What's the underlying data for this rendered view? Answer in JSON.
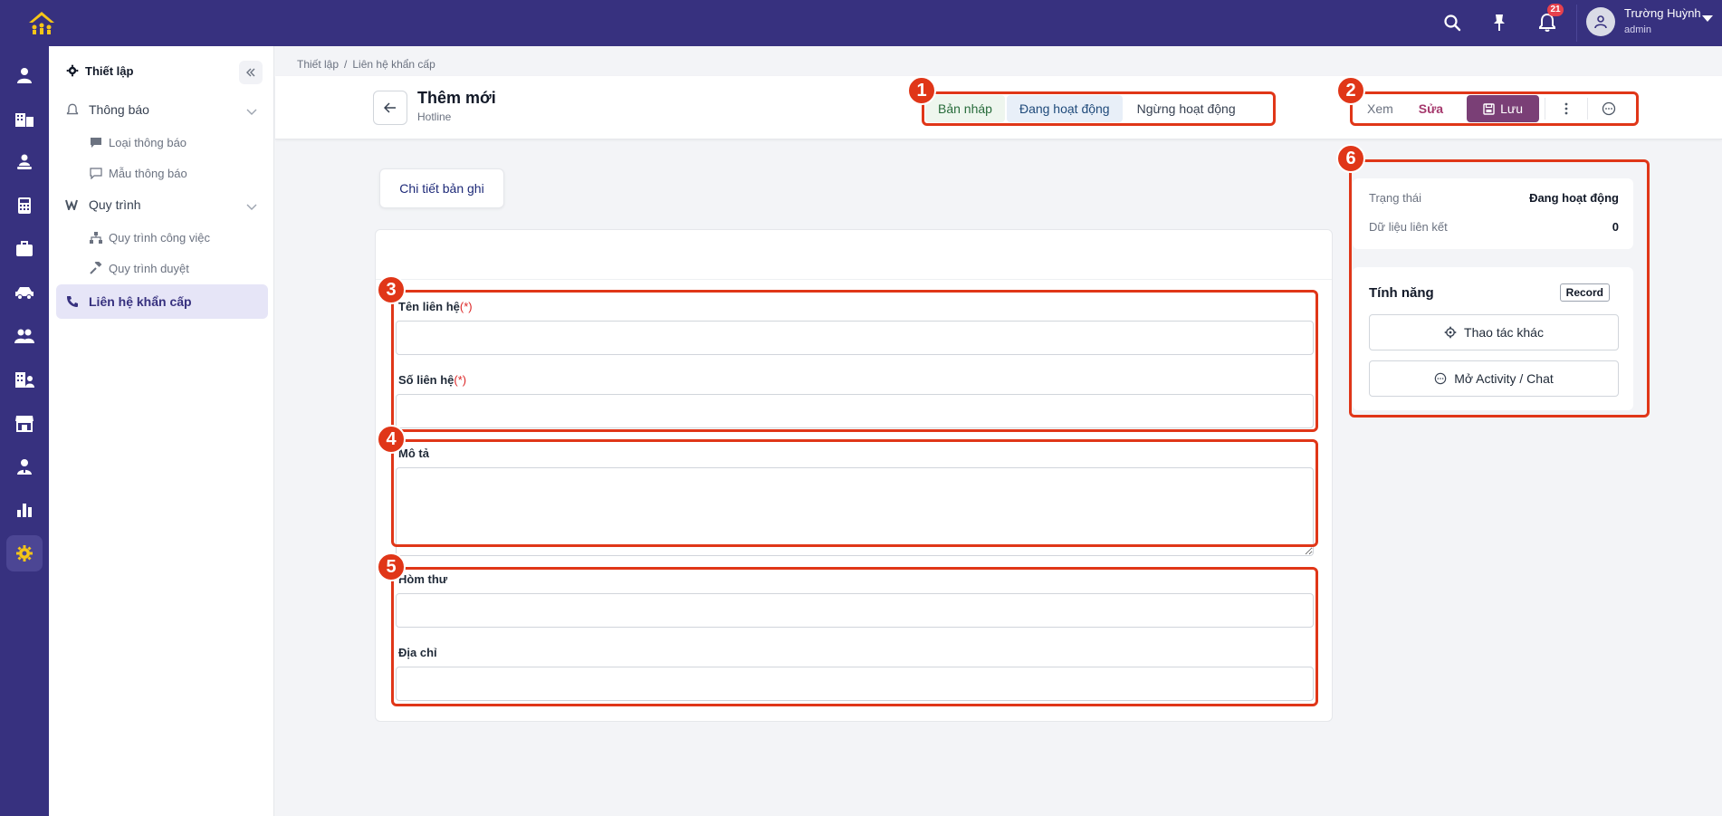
{
  "colors": {
    "topbar": "#37317f",
    "accent": "#37317f",
    "save_button": "#7a3f76",
    "annotation": "#e03618",
    "required": "#dc2626"
  },
  "topbar": {
    "notification_count": "21",
    "user_name": "Trường Huỳnh",
    "user_role": "admin",
    "icons": [
      "search-icon",
      "pin-icon",
      "bell-icon",
      "user-icon"
    ]
  },
  "rail": {
    "icons": [
      "person-icon",
      "building-icon",
      "user-group-icon",
      "calculator-icon",
      "briefcase-icon",
      "car-icon",
      "people-icon",
      "office-icon",
      "store-icon",
      "employee-icon",
      "chart-icon",
      "gear-icon"
    ],
    "active": "gear-icon"
  },
  "sidebar": {
    "title": "Thiết lập",
    "groups": [
      {
        "label": "Thông báo",
        "items": [
          "Loại thông báo",
          "Mẫu thông báo"
        ]
      },
      {
        "label": "Quy trình",
        "items": [
          "Quy trình công việc",
          "Quy trình duyệt"
        ]
      }
    ],
    "active_item": "Liên hệ khẩn cấp"
  },
  "breadcrumb": [
    "Thiết lập",
    "Liên hệ khẩn cấp"
  ],
  "header": {
    "title": "Thêm mới",
    "subtitle": "Hotline"
  },
  "status_tabs": [
    "Bản nháp",
    "Đang hoạt động",
    "Ngừng hoạt động"
  ],
  "actions": {
    "view": "Xem",
    "edit": "Sửa",
    "save": "Lưu"
  },
  "record_tab": "Chi tiết bản ghi",
  "form": {
    "contact_name": {
      "label": "Tên liên hệ",
      "required_mark": "(*)",
      "value": ""
    },
    "contact_number": {
      "label": "Số liên hệ",
      "required_mark": "(*)",
      "value": ""
    },
    "description": {
      "label": "Mô tả",
      "value": ""
    },
    "mailbox": {
      "label": "Hòm thư",
      "value": ""
    },
    "address": {
      "label": "Địa chỉ",
      "value": ""
    }
  },
  "info": {
    "status_label": "Trạng thái",
    "status_value": "Đang hoạt động",
    "linked_label": "Dữ liệu liên kết",
    "linked_value": "0"
  },
  "features": {
    "title": "Tính năng",
    "badge": "Record",
    "other_actions": "Thao tác khác",
    "open_activity": "Mở Activity / Chat"
  },
  "annotations": [
    "1",
    "2",
    "3",
    "4",
    "5",
    "6"
  ]
}
